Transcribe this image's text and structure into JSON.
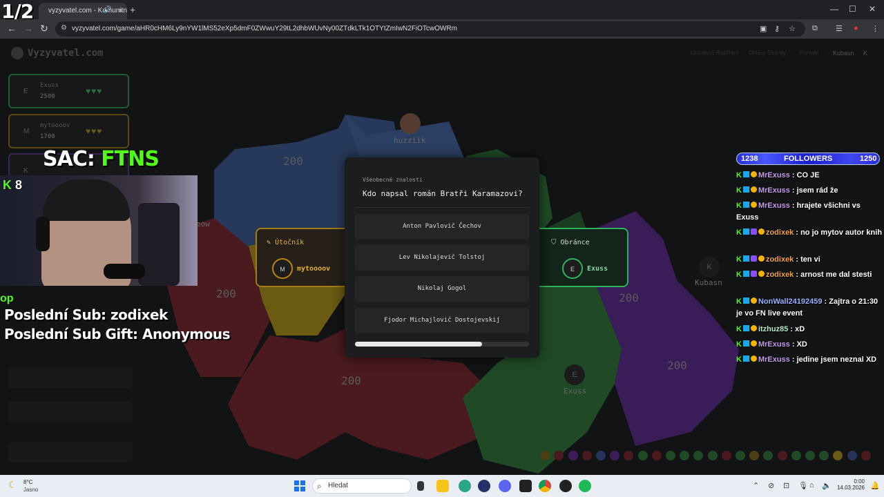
{
  "overlay_counter": "1/2",
  "browser": {
    "tab_title": "vyzyvatel.com - Komunitní",
    "url": "vyzyvatel.com/game/aHR0cHM6Ly9nYW1lMS52eXp5dmF0ZWwuY29tL2dhbWUvNy00ZTdkLTk1OTYtZmIwN2FiOTcwOWRm",
    "controls": {
      "minimize": "—",
      "maximize": "☐",
      "close": "✕"
    }
  },
  "site": {
    "brand": "Vyzyvatel.com",
    "nav": [
      "Ukázkový Rozhrání",
      "Ohlasy Stránky",
      "Kontakt"
    ],
    "user": "Kubasn",
    "user_initial": "K"
  },
  "players": [
    {
      "initial": "E",
      "name": "Exuss",
      "score": "2500",
      "hearts": "♥♥♥",
      "color": "#2db35a"
    },
    {
      "initial": "M",
      "name": "mytoooov",
      "score": "1700",
      "hearts": "♥♥♥",
      "color": "#b8860b"
    },
    {
      "initial": "K",
      "name": "",
      "score": "",
      "hearts": "",
      "color": "#7b3fc4"
    }
  ],
  "map": {
    "values": [
      "200",
      "200",
      "200",
      "200",
      "200"
    ],
    "labels": {
      "huzziik": "huzziik",
      "kubasn": "Kubasn",
      "exuss": "Exuss",
      "eow": "eow"
    },
    "avatars": {
      "kubasn": "K",
      "exuss": "E"
    }
  },
  "attacker": {
    "title": "Útočník",
    "initial": "M",
    "name": "mytoooov"
  },
  "defender": {
    "title": "Obránce",
    "initial": "E",
    "name": "Exuss"
  },
  "quiz": {
    "category": "Všeobecné znalosti",
    "question": "Kdo napsal román Bratři Karamazovi?",
    "answers": [
      "Anton Pavlovič Čechov",
      "Lev Nikolajevič Tolstoj",
      "Nikolaj Gogol",
      "Fjodor Michajlovič Dostojevskij"
    ],
    "time_remaining_fraction": 0.73
  },
  "stream": {
    "sac_prefix": "SAC: ",
    "sac_team": "FTNS",
    "kick_icon": "K",
    "viewer_count": "8",
    "op_label": "op",
    "last_sub": "Poslední Sub: zodixek",
    "last_gift": "Poslední Sub Gift: Anonymous"
  },
  "followers": {
    "current": "1238",
    "label": "FOLLOWERS",
    "goal": "1250"
  },
  "chat": [
    {
      "user": "MrExuss",
      "msg": " : CO JE"
    },
    {
      "user": "MrExuss",
      "msg": " : jsem rád že"
    },
    {
      "user": "MrExuss",
      "msg": " : hrajete všichni vs Exuss"
    },
    {
      "user": "zodixek",
      "msg": " : no jo mytov autor knih"
    },
    {
      "user": "zodixek",
      "msg": " : ten vi"
    },
    {
      "user": "zodixek",
      "msg": " : arnost me dal stesti"
    },
    {
      "user": "NonWall24192459",
      "msg": " : Zajtra o 21:30 je vo FN live event"
    },
    {
      "user": "itzhuz85",
      "msg": " : xD"
    },
    {
      "user": "MrExuss",
      "msg": " : XD"
    },
    {
      "user": "MrExuss",
      "msg": " : jedine jsem neznal XD"
    }
  ],
  "taskbar": {
    "weather_temp": "8°C",
    "weather_desc": "Jasno",
    "search_placeholder": "Hledat",
    "time": "0:00",
    "date": "14.03.2026"
  }
}
